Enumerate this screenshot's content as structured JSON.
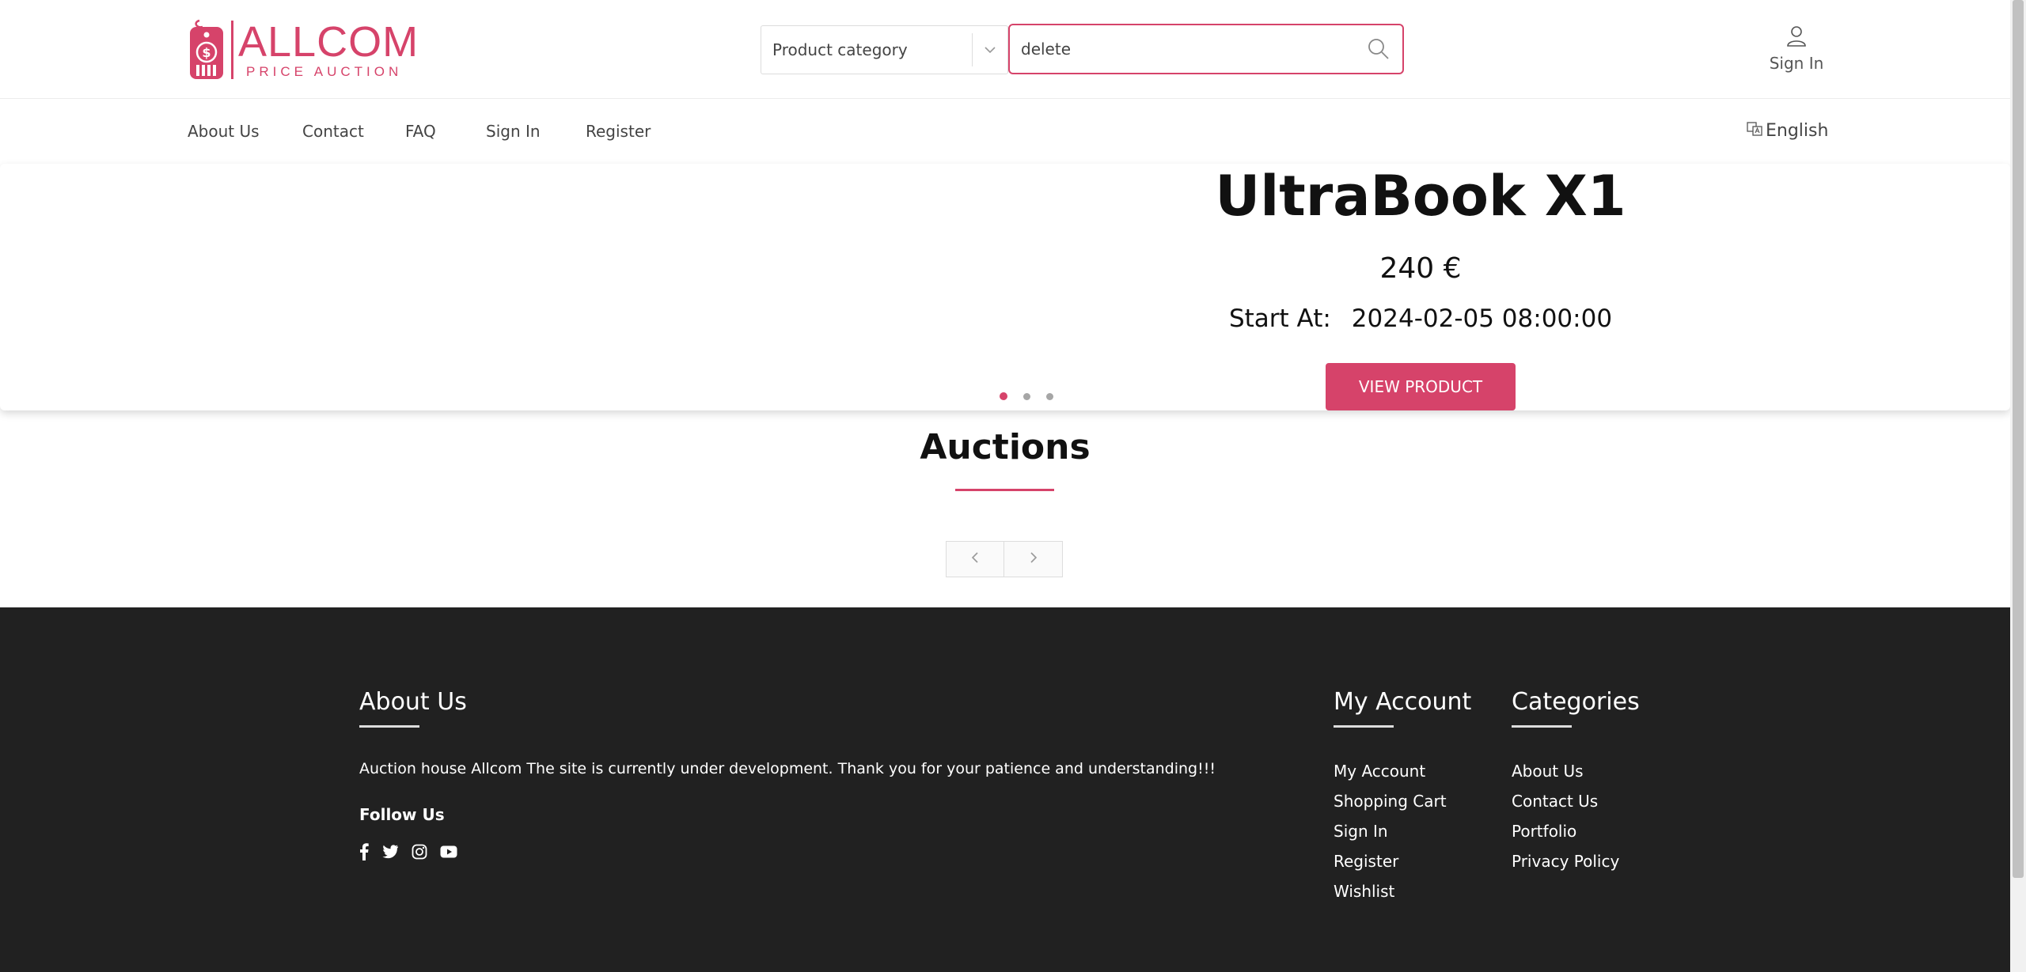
{
  "brand": {
    "title": "ALLCOM",
    "subtitle": "PRICE AUCTION",
    "color": "#d6436a"
  },
  "header": {
    "category_label": "Product category",
    "search_value": "delete",
    "signin_label": "Sign In"
  },
  "nav": {
    "items": [
      {
        "label": "About Us"
      },
      {
        "label": "Contact"
      },
      {
        "label": "FAQ"
      },
      {
        "label": "Sign In"
      },
      {
        "label": "Register"
      }
    ],
    "language": "English"
  },
  "slider": {
    "title": "UltraBook X1",
    "price": "240 €",
    "start_label": "Start At:",
    "start_value": "2024-02-05 08:00:00",
    "button_label": "VIEW PRODUCT",
    "dots": 3,
    "active_dot": 1
  },
  "auctions": {
    "title": "Auctions"
  },
  "footer": {
    "about_title": "About Us",
    "about_text": "Auction house Allcom The site is currently under development. Thank you for your patience and understanding!!!",
    "follow_title": "Follow Us",
    "socials": [
      "facebook-icon",
      "twitter-icon",
      "instagram-icon",
      "youtube-icon"
    ],
    "account_title": "My Account",
    "account_links": [
      "My Account",
      "Shopping Cart",
      "Sign In",
      "Register",
      "Wishlist"
    ],
    "categories_title": "Categories",
    "category_links": [
      "About Us",
      "Contact Us",
      "Portfolio",
      "Privacy Policy"
    ]
  }
}
